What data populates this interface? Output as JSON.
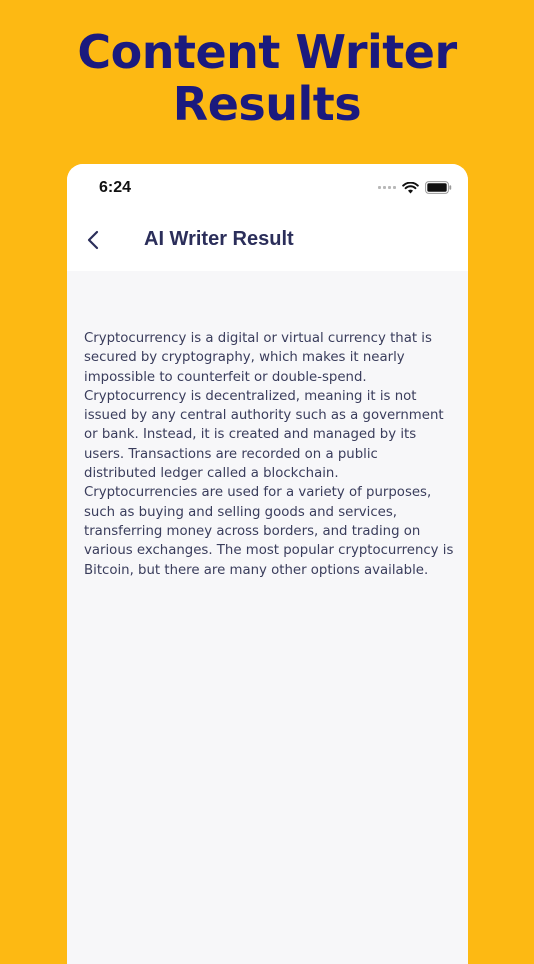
{
  "promo": {
    "title_line1": "Content Writer",
    "title_line2": "Results"
  },
  "status_bar": {
    "time": "6:24",
    "icons": [
      "signal-dots-icon",
      "wifi-icon",
      "battery-icon"
    ]
  },
  "header": {
    "back_icon": "chevron-left-icon",
    "title": "AI Writer Result"
  },
  "result": {
    "text": "Cryptocurrency is a digital or virtual currency that is secured by cryptography, which makes it nearly impossible to counterfeit or double-spend. Cryptocurrency is decentralized, meaning it is not issued by any central authority such as a government or bank. Instead, it is created and managed by its users. Transactions are recorded on a public distributed ledger called a blockchain. Cryptocurrencies are used for a variety of purposes, such as buying and selling goods and services, transferring money across borders, and trading on various exchanges. The most popular cryptocurrency is Bitcoin, but there are many other options available."
  },
  "colors": {
    "background": "#FDB913",
    "headline": "#1B1A7E",
    "screen_background": "#F7F7F9",
    "text": "#3A3D5C"
  }
}
